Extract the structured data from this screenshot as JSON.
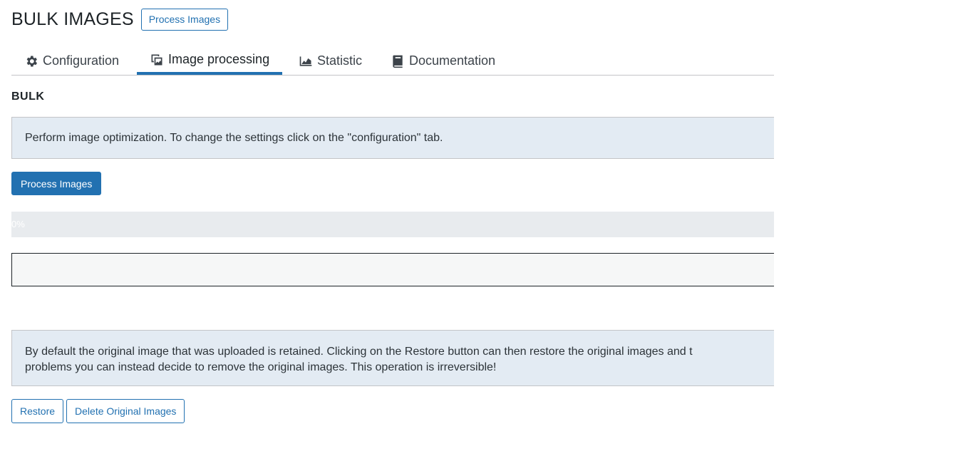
{
  "page": {
    "title": "BULK IMAGES",
    "header_button": "Process Images"
  },
  "tabs": [
    {
      "label": "Configuration",
      "icon": "gear-icon",
      "active": false
    },
    {
      "label": "Image processing",
      "icon": "images-icon",
      "active": true
    },
    {
      "label": "Statistic",
      "icon": "chart-area-icon",
      "active": false
    },
    {
      "label": "Documentation",
      "icon": "book-icon",
      "active": false
    }
  ],
  "bulk": {
    "title": "BULK",
    "notice": "Perform image optimization. To change the settings click on the \"configuration\" tab.",
    "process_button": "Process Images",
    "progress": {
      "value_percent": 0,
      "label": "0%"
    }
  },
  "restore": {
    "notice": "By default the original image that was uploaded is retained. Clicking on the Restore button can then restore the original images and the problems you can instead decide to remove the original images. This operation is irreversible!",
    "notice_line1": "By default the original image that was uploaded is retained. Clicking on the Restore button can then restore the original images and t",
    "notice_line2": "problems you can instead decide to remove the original images. This operation is irreversible!",
    "restore_button": "Restore",
    "delete_button": "Delete Original Images"
  },
  "colors": {
    "accent": "#2271b1",
    "notice_bg": "#e3ebf3",
    "progress_bg": "#e8ebee"
  }
}
